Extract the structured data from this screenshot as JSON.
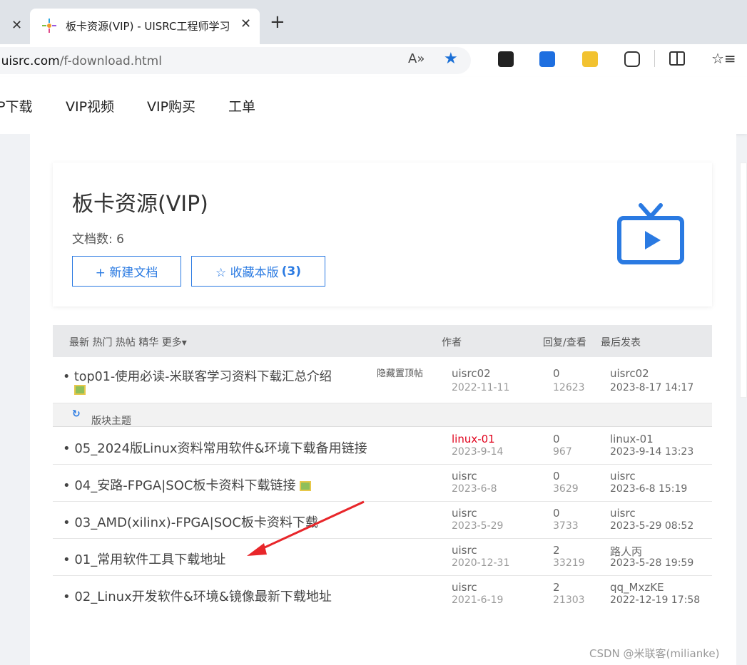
{
  "browser": {
    "tab_title": "板卡资源(VIP) - UISRC工程师学习",
    "url_host": "ww.uisrc.com",
    "url_path": "/f-download.html"
  },
  "nav": [
    "P下载",
    "VIP视频",
    "VIP购买",
    "工单"
  ],
  "forum": {
    "title": "板卡资源(VIP)",
    "doc_count": "文档数: 6",
    "new_doc_button": "+ 新建文档",
    "favorite_button": "☆ 收藏本版",
    "favorite_count": "(3)"
  },
  "table_header": {
    "filters": "最新  热门  热帖  精华  更多▾",
    "author": "作者",
    "reply_view": "回复/查看",
    "last_post": "最后发表"
  },
  "pinned": {
    "title": "top01-使用必读-米联客学习资料下载汇总介绍",
    "hide_pinned": "隐藏置顶帖",
    "author": "uisrc02",
    "date": "2022-11-11",
    "replies": "0",
    "views": "12623",
    "last_user": "uisrc02",
    "last_date": "2023-8-17 14:17"
  },
  "section_label": "版块主题",
  "threads": [
    {
      "title": "05_2024版Linux资料常用软件&环境下载备用链接",
      "author": "linux-01",
      "date": "2023-9-14",
      "replies": "0",
      "views": "967",
      "last_user": "linux-01",
      "last_date": "2023-9-14 13:23"
    },
    {
      "title": "04_安路-FPGA|SOC板卡资料下载链接",
      "author": "uisrc",
      "date": "2023-6-8",
      "replies": "0",
      "views": "3629",
      "last_user": "uisrc",
      "last_date": "2023-6-8 15:19"
    },
    {
      "title": "03_AMD(xilinx)-FPGA|SOC板卡资料下载",
      "author": "uisrc",
      "date": "2023-5-29",
      "replies": "0",
      "views": "3733",
      "last_user": "uisrc",
      "last_date": "2023-5-29 08:52"
    },
    {
      "title": "01_常用软件工具下载地址",
      "author": "uisrc",
      "date": "2020-12-31",
      "replies": "2",
      "views": "33219",
      "last_user": "路人丙",
      "last_date": "2023-5-28 19:59"
    },
    {
      "title": "02_Linux开发软件&环境&镜像最新下载地址",
      "author": "uisrc",
      "date": "2021-6-19",
      "replies": "2",
      "views": "21303",
      "last_user": "qq_MxzKE",
      "last_date": "2022-12-19 17:58"
    }
  ],
  "watermark": "CSDN @米联客(milianke)",
  "colors": {
    "accent": "#2a7ae2",
    "highlight_author": "#e0001b",
    "arrow": "#e8262a"
  }
}
